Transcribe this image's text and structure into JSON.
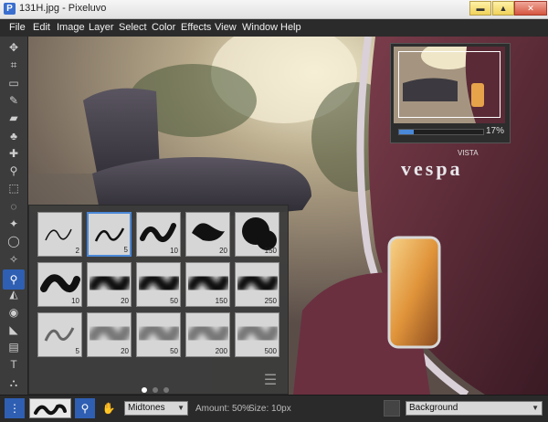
{
  "window": {
    "title": "131H.jpg - Pixeluvo",
    "app_icon": "P",
    "controls": [
      "minimize",
      "maximize",
      "close"
    ]
  },
  "menu": [
    "File",
    "Edit",
    "Image",
    "Layer",
    "Select",
    "Color",
    "Effects",
    "View",
    "Window",
    "Help"
  ],
  "tools": [
    {
      "name": "move-tool-icon",
      "glyph": "✥"
    },
    {
      "name": "crop-tool-icon",
      "glyph": "⌗"
    },
    {
      "name": "transform-tool-icon",
      "glyph": "▭"
    },
    {
      "name": "brush-tool-icon",
      "glyph": "✎"
    },
    {
      "name": "eraser-tool-icon",
      "glyph": "▰"
    },
    {
      "name": "clone-tool-icon",
      "glyph": "♣"
    },
    {
      "name": "heal-tool-icon",
      "glyph": "✚"
    },
    {
      "name": "dropper-tool-icon",
      "glyph": "⚲"
    },
    {
      "name": "rect-select-tool-icon",
      "glyph": "⬚"
    },
    {
      "name": "lasso-tool-icon",
      "glyph": "◌"
    },
    {
      "name": "magic-wand-tool-icon",
      "glyph": "✦"
    },
    {
      "name": "ellipse-select-tool-icon",
      "glyph": "◯"
    },
    {
      "name": "path-tool-icon",
      "glyph": "✧"
    },
    {
      "name": "dodge-burn-tool-icon",
      "glyph": "⚲",
      "active": true
    },
    {
      "name": "sharpen-tool-icon",
      "glyph": "◭"
    },
    {
      "name": "red-eye-tool-icon",
      "glyph": "◉"
    },
    {
      "name": "fill-tool-icon",
      "glyph": "◣"
    },
    {
      "name": "gradient-tool-icon",
      "glyph": "▤"
    },
    {
      "name": "text-tool-icon",
      "glyph": "T"
    },
    {
      "name": "shape-tool-icon",
      "glyph": "⛬"
    }
  ],
  "navigator": {
    "zoom_label": "17%",
    "zoom_fraction": 0.17
  },
  "canvas": {
    "brand_text": "vespa",
    "tag_text": "VISTA"
  },
  "brushes": [
    {
      "size": "2",
      "style": "scribble-thin"
    },
    {
      "size": "5",
      "style": "scribble"
    },
    {
      "size": "10",
      "style": "scribble-bold"
    },
    {
      "size": "20",
      "style": "blob"
    },
    {
      "size": "150",
      "style": "blob-large"
    },
    {
      "size": "10",
      "style": "hard-stroke"
    },
    {
      "size": "20",
      "style": "soft-stroke"
    },
    {
      "size": "50",
      "style": "soft-stroke"
    },
    {
      "size": "150",
      "style": "soft-stroke"
    },
    {
      "size": "250",
      "style": "soft-stroke"
    },
    {
      "size": "5",
      "style": "faded-scribble"
    },
    {
      "size": "20",
      "style": "faded-soft"
    },
    {
      "size": "50",
      "style": "faded-soft"
    },
    {
      "size": "200",
      "style": "faded-soft"
    },
    {
      "size": "500",
      "style": "faded-soft"
    }
  ],
  "brush_pages": {
    "count": 3,
    "current": 0
  },
  "status": {
    "range_label": "Midtones",
    "amount_text": "Amount: 50%",
    "size_text": "Size: 10px",
    "layer_label": "Background"
  }
}
